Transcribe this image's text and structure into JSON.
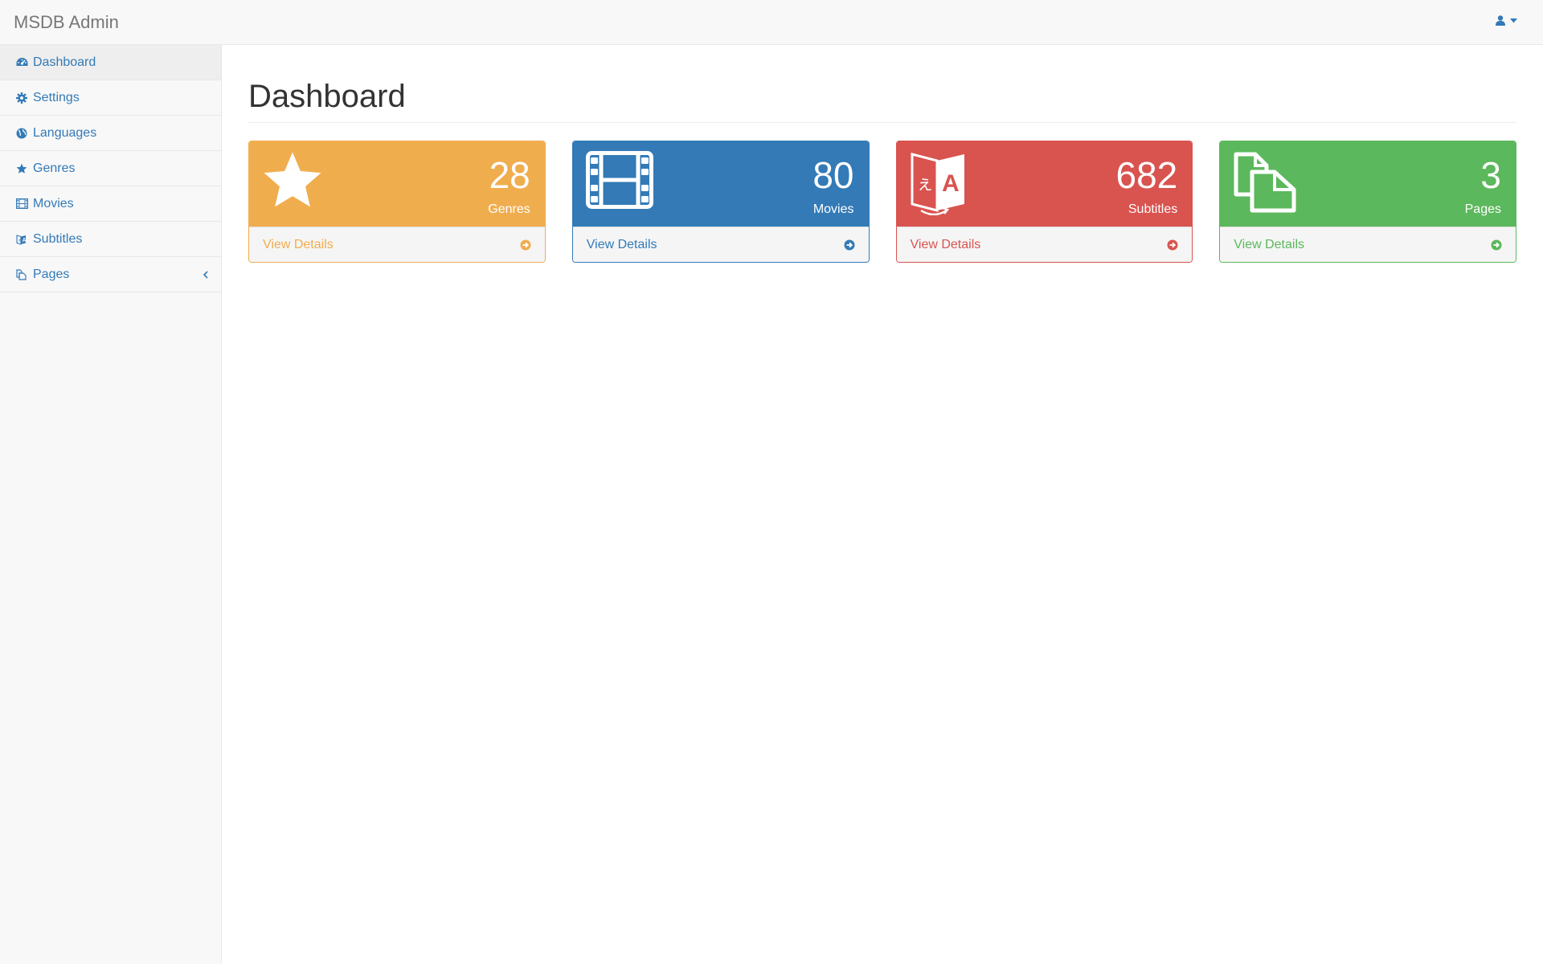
{
  "app": {
    "brand": "MSDB Admin"
  },
  "header": {
    "user_icon": "user-icon"
  },
  "sidebar": {
    "items": [
      {
        "label": "Dashboard",
        "icon": "dashboard-icon",
        "active": true
      },
      {
        "label": "Settings",
        "icon": "gear-icon"
      },
      {
        "label": "Languages",
        "icon": "globe-icon"
      },
      {
        "label": "Genres",
        "icon": "star-icon"
      },
      {
        "label": "Movies",
        "icon": "film-icon"
      },
      {
        "label": "Subtitles",
        "icon": "language-icon"
      },
      {
        "label": "Pages",
        "icon": "files-icon",
        "expandable": true
      }
    ]
  },
  "main": {
    "title": "Dashboard",
    "panels": [
      {
        "count": "28",
        "label": "Genres",
        "footer": "View Details",
        "color": "#f0ad4e",
        "icon": "star-icon"
      },
      {
        "count": "80",
        "label": "Movies",
        "footer": "View Details",
        "color": "#337ab7",
        "icon": "film-icon"
      },
      {
        "count": "682",
        "label": "Subtitles",
        "footer": "View Details",
        "color": "#d9534f",
        "icon": "language-icon"
      },
      {
        "count": "3",
        "label": "Pages",
        "footer": "View Details",
        "color": "#5cb85c",
        "icon": "files-icon"
      }
    ]
  }
}
